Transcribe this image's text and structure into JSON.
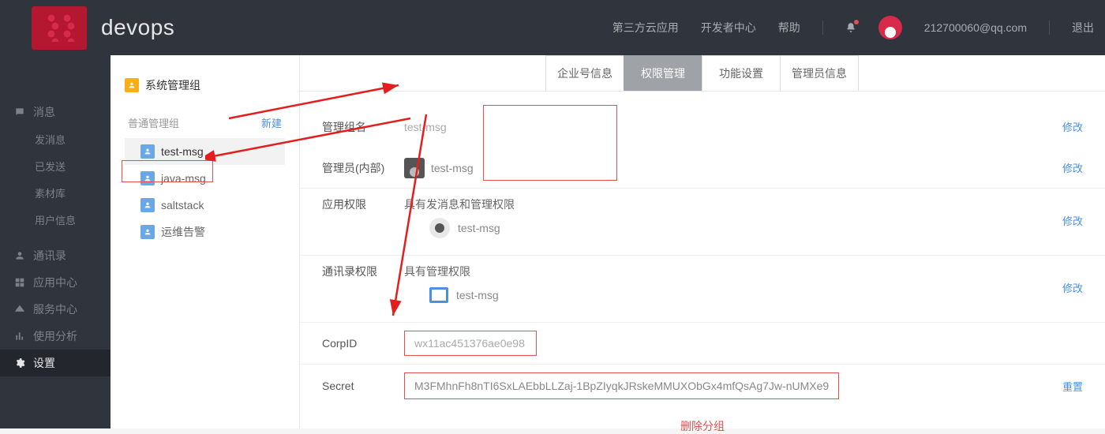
{
  "topbar": {
    "app_title": "devops",
    "links": {
      "third_party": "第三方云应用",
      "dev_center": "开发者中心",
      "help": "帮助"
    },
    "user_email": "212700060@qq.com",
    "logout": "退出"
  },
  "sidenav": {
    "msg": "消息",
    "send_msg": "发消息",
    "sent": "已发送",
    "material": "素材库",
    "user_info": "用户信息",
    "contacts": "通讯录",
    "app_center": "应用中心",
    "service_center": "服务中心",
    "analytics": "使用分析",
    "settings": "设置"
  },
  "groups_panel": {
    "system_group": "系统管理组",
    "normal_group": "普通管理组",
    "create": "新建",
    "items": [
      {
        "name": "test-msg"
      },
      {
        "name": "java-msg"
      },
      {
        "name": "saltstack"
      },
      {
        "name": "运维告警"
      }
    ]
  },
  "tabs": {
    "t1": "企业号信息",
    "t2": "权限管理",
    "t3": "功能设置",
    "t4": "管理员信息"
  },
  "detail": {
    "group_name_label": "管理组名",
    "group_name_value": "test-msg",
    "admin_label": "管理员(内部)",
    "admin_value": "test-msg",
    "app_perm_label": "应用权限",
    "app_perm_desc": "具有发消息和管理权限",
    "app_perm_item": "test-msg",
    "contact_perm_label": "通讯录权限",
    "contact_perm_desc": "具有管理权限",
    "contact_perm_item": "test-msg",
    "corpid_label": "CorpID",
    "corpid_value": "wx11ac451376ae0e98",
    "secret_label": "Secret",
    "secret_value": "M3FMhnFh8nTI6SxLAEbbLLZaj-1BpZIyqkJRskeMMUXObGx4mfQsAg7Jw-nUMXe9",
    "modify": "修改",
    "reset": "重置",
    "delete_group": "删除分组"
  }
}
